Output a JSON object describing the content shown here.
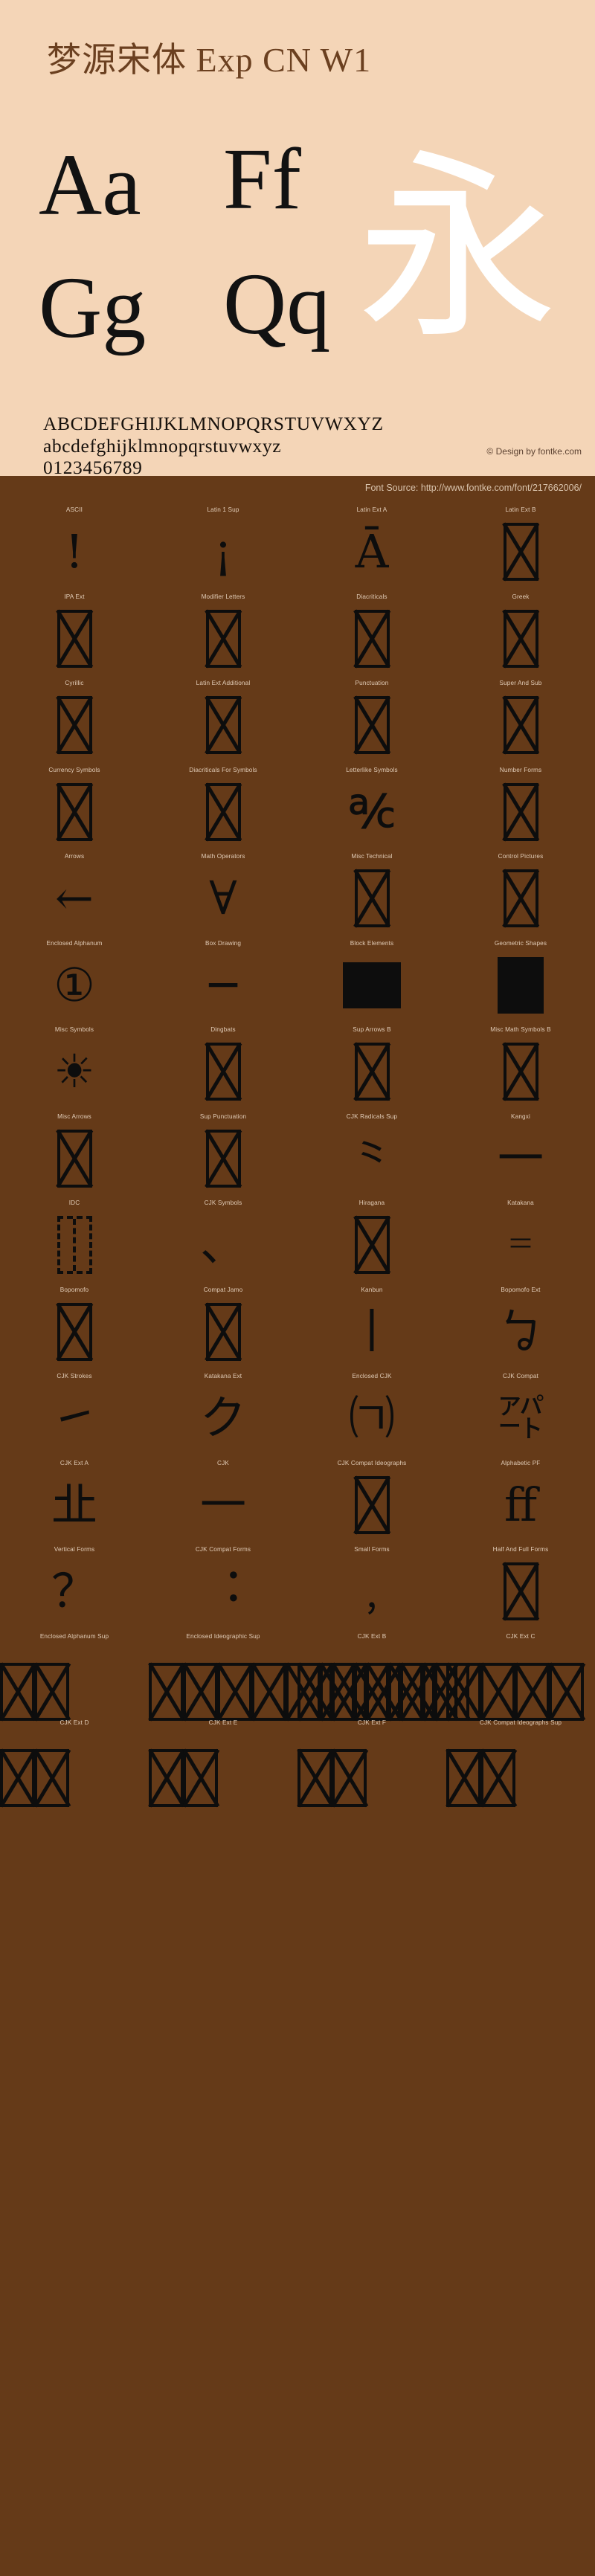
{
  "header": {
    "title": "梦源宋体 Exp CN W1",
    "samples": {
      "aa": "Aa",
      "gg": "Gg",
      "ff": "Ff",
      "qq": "Qq",
      "cjk": "永"
    },
    "alphabet_upper": "ABCDEFGHIJKLMNOPQRSTUVWXYZ",
    "alphabet_lower": "abcdefghijklmnopqrstuvwxyz",
    "digits": "0123456789",
    "copyright": "© Design by fontke.com"
  },
  "source": {
    "label": "Font Source: http://www.fontke.com/font/217662006/"
  },
  "grid": {
    "rows": [
      [
        {
          "label": "ASCII",
          "glyph": "!",
          "kind": "glyph"
        },
        {
          "label": "Latin 1 Sup",
          "glyph": "¡",
          "kind": "glyph"
        },
        {
          "label": "Latin Ext A",
          "glyph": "Ā",
          "kind": "glyph"
        },
        {
          "label": "Latin Ext B",
          "glyph": "",
          "kind": "tofu"
        }
      ],
      [
        {
          "label": "IPA Ext",
          "glyph": "",
          "kind": "tofu"
        },
        {
          "label": "Modifier Letters",
          "glyph": "",
          "kind": "tofu"
        },
        {
          "label": "Diacriticals",
          "glyph": "",
          "kind": "tofu"
        },
        {
          "label": "Greek",
          "glyph": "",
          "kind": "tofu"
        }
      ],
      [
        {
          "label": "Cyrillic",
          "glyph": "",
          "kind": "tofu"
        },
        {
          "label": "Latin Ext Additional",
          "glyph": "",
          "kind": "tofu"
        },
        {
          "label": "Punctuation",
          "glyph": "",
          "kind": "tofu"
        },
        {
          "label": "Super And Sub",
          "glyph": "",
          "kind": "tofu"
        }
      ],
      [
        {
          "label": "Currency Symbols",
          "glyph": "",
          "kind": "tofu"
        },
        {
          "label": "Diacriticals For Symbols",
          "glyph": "",
          "kind": "tofu"
        },
        {
          "label": "Letterlike Symbols",
          "glyph": "℀",
          "kind": "glyph"
        },
        {
          "label": "Number Forms",
          "glyph": "",
          "kind": "tofu"
        }
      ],
      [
        {
          "label": "Arrows",
          "glyph": "←",
          "kind": "glyph"
        },
        {
          "label": "Math Operators",
          "glyph": "∀",
          "kind": "glyph"
        },
        {
          "label": "Misc Technical",
          "glyph": "",
          "kind": "tofu"
        },
        {
          "label": "Control Pictures",
          "glyph": "",
          "kind": "tofu"
        }
      ],
      [
        {
          "label": "Enclosed Alphanum",
          "glyph": "①",
          "kind": "glyph"
        },
        {
          "label": "Box Drawing",
          "glyph": "─",
          "kind": "glyph"
        },
        {
          "label": "Block Elements",
          "glyph": "",
          "kind": "block-wide"
        },
        {
          "label": "Geometric Shapes",
          "glyph": "",
          "kind": "block-tall"
        }
      ],
      [
        {
          "label": "Misc Symbols",
          "glyph": "☀",
          "kind": "glyph"
        },
        {
          "label": "Dingbats",
          "glyph": "",
          "kind": "tofu"
        },
        {
          "label": "Sup Arrows B",
          "glyph": "",
          "kind": "tofu"
        },
        {
          "label": "Misc Math Symbols B",
          "glyph": "",
          "kind": "tofu"
        }
      ],
      [
        {
          "label": "Misc Arrows",
          "glyph": "",
          "kind": "tofu"
        },
        {
          "label": "Sup Punctuation",
          "glyph": "",
          "kind": "tofu"
        },
        {
          "label": "CJK Radicals Sup",
          "glyph": "⺀",
          "kind": "glyph"
        },
        {
          "label": "Kangxi",
          "glyph": "⼀",
          "kind": "glyph"
        }
      ],
      [
        {
          "label": "IDC",
          "glyph": "⿰",
          "kind": "idc"
        },
        {
          "label": "CJK Symbols",
          "glyph": "、",
          "kind": "glyph"
        },
        {
          "label": "Hiragana",
          "glyph": "",
          "kind": "tofu"
        },
        {
          "label": "Katakana",
          "glyph": "゠",
          "kind": "glyph"
        }
      ],
      [
        {
          "label": "Bopomofo",
          "glyph": "",
          "kind": "tofu"
        },
        {
          "label": "Compat Jamo",
          "glyph": "",
          "kind": "tofu"
        },
        {
          "label": "Kanbun",
          "glyph": "丨",
          "kind": "glyph"
        },
        {
          "label": "Bopomofo Ext",
          "glyph": "ㆠ",
          "kind": "glyph"
        }
      ],
      [
        {
          "label": "CJK Strokes",
          "glyph": "㇀",
          "kind": "glyph"
        },
        {
          "label": "Katakana Ext",
          "glyph": "ク",
          "kind": "glyph"
        },
        {
          "label": "Enclosed CJK",
          "glyph": "㈀",
          "kind": "glyph"
        },
        {
          "label": "CJK Compat",
          "glyph": "㌀",
          "kind": "glyph"
        }
      ],
      [
        {
          "label": "CJK Ext A",
          "glyph": "㐀",
          "kind": "glyph"
        },
        {
          "label": "CJK",
          "glyph": "一",
          "kind": "glyph"
        },
        {
          "label": "CJK Compat Ideographs",
          "glyph": "",
          "kind": "tofu"
        },
        {
          "label": "Alphabetic PF",
          "glyph": "ﬀ",
          "kind": "glyph"
        }
      ],
      [
        {
          "label": "Vertical Forms",
          "glyph": "？",
          "kind": "glyph"
        },
        {
          "label": "CJK Compat Forms",
          "glyph": "︓",
          "kind": "glyph"
        },
        {
          "label": "Small Forms",
          "glyph": "﹐",
          "kind": "glyph"
        },
        {
          "label": "Half And Full Forms",
          "glyph": "",
          "kind": "tofu"
        }
      ],
      [
        {
          "label": "Enclosed Alphanum Sup",
          "glyph": "",
          "kind": "overflow",
          "count": 2
        },
        {
          "label": "Enclosed Ideographic Sup",
          "glyph": "",
          "kind": "overflow",
          "count": 9
        },
        {
          "label": "CJK Ext B",
          "glyph": "",
          "kind": "overflow",
          "count": 5
        },
        {
          "label": "CJK Ext C",
          "glyph": "",
          "kind": "overflow",
          "count": 4
        }
      ],
      [
        {
          "label": "CJK Ext D",
          "glyph": "",
          "kind": "overflow",
          "count": 2
        },
        {
          "label": "CJK Ext E",
          "glyph": "",
          "kind": "overflow",
          "count": 2
        },
        {
          "label": "CJK Ext F",
          "glyph": "",
          "kind": "overflow",
          "count": 2
        },
        {
          "label": "CJK Compat Ideographs Sup",
          "glyph": "",
          "kind": "overflow",
          "count": 2
        }
      ]
    ]
  },
  "colors": {
    "header_bg": "#f4d5b7",
    "body_bg": "#653a18",
    "title": "#6b4020",
    "glyph": "#0d0d0d",
    "label": "#e2cdb8",
    "cjk_sample": "#ffffff"
  }
}
